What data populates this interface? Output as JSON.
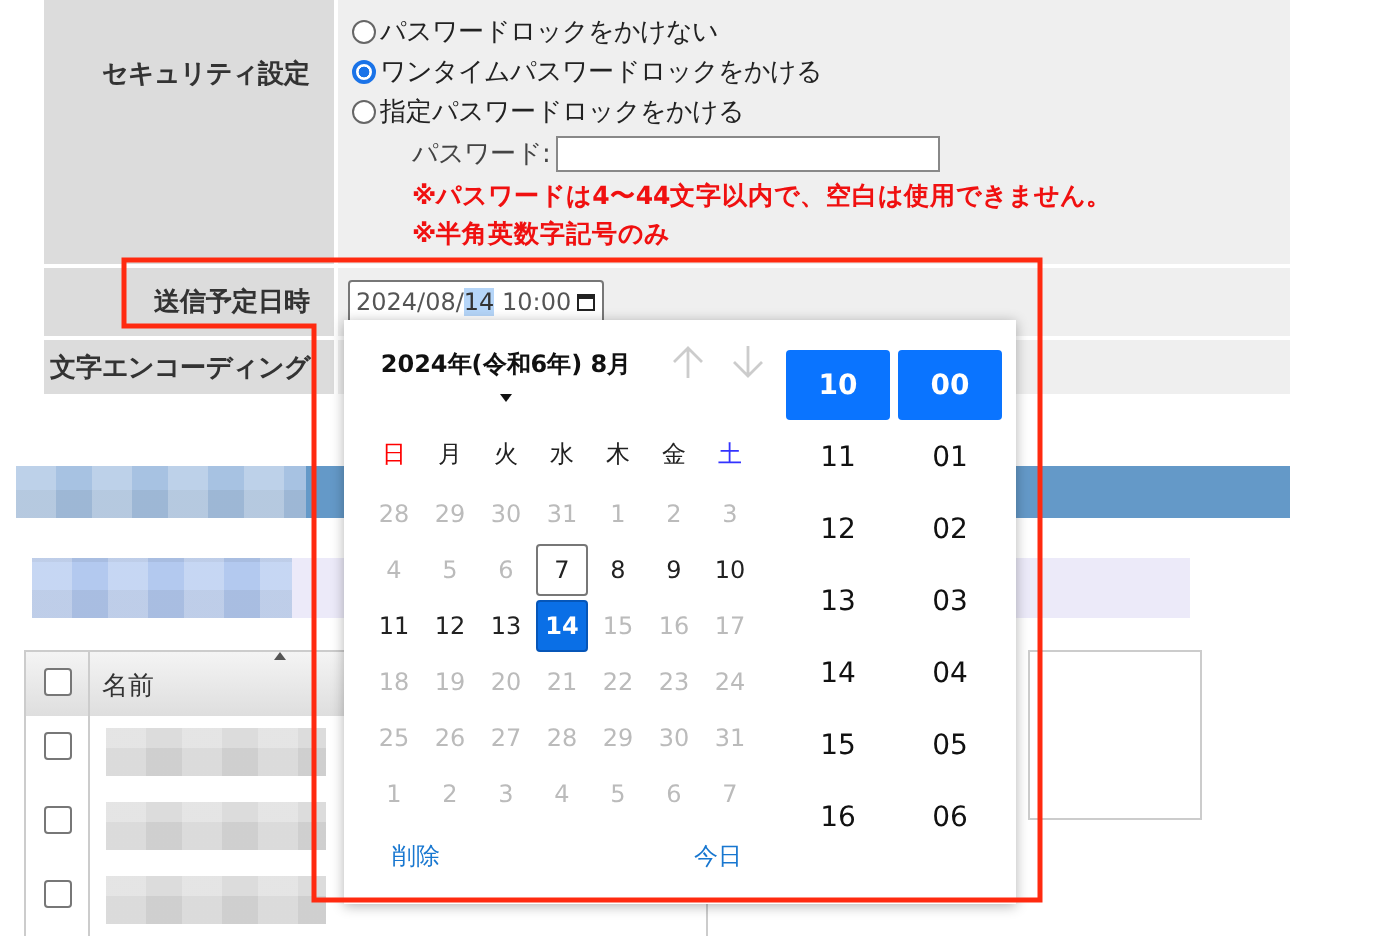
{
  "security": {
    "label": "セキュリティ設定",
    "options": [
      {
        "label": "パスワードロックをかけない",
        "selected": false
      },
      {
        "label": "ワンタイムパスワードロックをかける",
        "selected": true
      },
      {
        "label": "指定パスワードロックをかける",
        "selected": false
      }
    ],
    "password_label": "パスワード:",
    "notes": [
      "※パスワードは4〜44文字以内で、空白は使用できません。",
      "※半角英数字記号のみ"
    ]
  },
  "schedule": {
    "label": "送信予定日時",
    "segments": [
      {
        "text": "2024/08/",
        "selected": false
      },
      {
        "text": "14",
        "selected": true
      },
      {
        "text": " 10:00",
        "selected": false
      }
    ]
  },
  "encoding": {
    "label": "文字エンコーディング"
  },
  "list": {
    "header": "名前",
    "header_checked": false,
    "rows": [
      {
        "checked": false
      },
      {
        "checked": false
      },
      {
        "checked": false
      }
    ]
  },
  "calendar": {
    "month_title": "2024年(令和6年) 8月",
    "weekdays": [
      {
        "label": "日",
        "kind": "sun"
      },
      {
        "label": "月",
        "kind": "weekday"
      },
      {
        "label": "火",
        "kind": "weekday"
      },
      {
        "label": "水",
        "kind": "weekday"
      },
      {
        "label": "木",
        "kind": "weekday"
      },
      {
        "label": "金",
        "kind": "weekday"
      },
      {
        "label": "土",
        "kind": "sat"
      }
    ],
    "weeks": [
      [
        {
          "day": "28",
          "disabled": true
        },
        {
          "day": "29",
          "disabled": true
        },
        {
          "day": "30",
          "disabled": true
        },
        {
          "day": "31",
          "disabled": true
        },
        {
          "day": "1",
          "disabled": true
        },
        {
          "day": "2",
          "disabled": true
        },
        {
          "day": "3",
          "disabled": true
        }
      ],
      [
        {
          "day": "4",
          "disabled": true
        },
        {
          "day": "5",
          "disabled": true
        },
        {
          "day": "6",
          "disabled": true
        },
        {
          "day": "7",
          "disabled": false,
          "today": true
        },
        {
          "day": "8",
          "disabled": false
        },
        {
          "day": "9",
          "disabled": false
        },
        {
          "day": "10",
          "disabled": false
        }
      ],
      [
        {
          "day": "11",
          "disabled": false
        },
        {
          "day": "12",
          "disabled": false
        },
        {
          "day": "13",
          "disabled": false
        },
        {
          "day": "14",
          "disabled": false,
          "selected": true
        },
        {
          "day": "15",
          "disabled": true
        },
        {
          "day": "16",
          "disabled": true
        },
        {
          "day": "17",
          "disabled": true
        }
      ],
      [
        {
          "day": "18",
          "disabled": true
        },
        {
          "day": "19",
          "disabled": true
        },
        {
          "day": "20",
          "disabled": true
        },
        {
          "day": "21",
          "disabled": true
        },
        {
          "day": "22",
          "disabled": true
        },
        {
          "day": "23",
          "disabled": true
        },
        {
          "day": "24",
          "disabled": true
        }
      ],
      [
        {
          "day": "25",
          "disabled": true
        },
        {
          "day": "26",
          "disabled": true
        },
        {
          "day": "27",
          "disabled": true
        },
        {
          "day": "28",
          "disabled": true
        },
        {
          "day": "29",
          "disabled": true
        },
        {
          "day": "30",
          "disabled": true
        },
        {
          "day": "31",
          "disabled": true
        }
      ],
      [
        {
          "day": "1",
          "disabled": true
        },
        {
          "day": "2",
          "disabled": true
        },
        {
          "day": "3",
          "disabled": true
        },
        {
          "day": "4",
          "disabled": true
        },
        {
          "day": "5",
          "disabled": true
        },
        {
          "day": "6",
          "disabled": true
        },
        {
          "day": "7",
          "disabled": true
        }
      ]
    ],
    "clear_label": "削除",
    "today_label": "今日",
    "hours": [
      {
        "label": "10",
        "selected": true
      },
      {
        "label": "11",
        "selected": false
      },
      {
        "label": "12",
        "selected": false
      },
      {
        "label": "13",
        "selected": false
      },
      {
        "label": "14",
        "selected": false
      },
      {
        "label": "15",
        "selected": false
      },
      {
        "label": "16",
        "selected": false
      }
    ],
    "minutes": [
      {
        "label": "00",
        "selected": true
      },
      {
        "label": "01",
        "selected": false
      },
      {
        "label": "02",
        "selected": false
      },
      {
        "label": "03",
        "selected": false
      },
      {
        "label": "04",
        "selected": false
      },
      {
        "label": "05",
        "selected": false
      },
      {
        "label": "06",
        "selected": false
      }
    ]
  }
}
